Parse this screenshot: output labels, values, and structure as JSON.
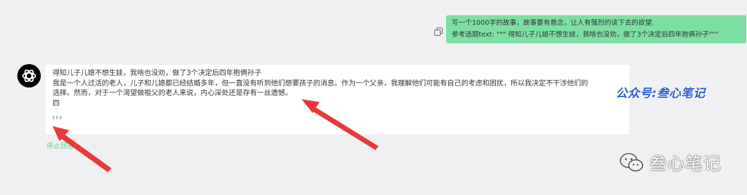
{
  "user_message": {
    "line1": "写一个1000字的故事，故事要有悬念，让人有强烈的读下去的欲望.",
    "line2": "参考选题text: \"\"\" 得知儿子儿媳不想生娃，我啥也没劝，做了3个决定后四年抱俩孙子\"\"\""
  },
  "assistant_message": {
    "title": "得知儿子儿媳不想生娃，我啥也没劝，做了3个决定后四年抱俩孙子",
    "para_line1": "我是一个人过活的老人，儿子和儿媳都已经结婚多年，但一直没有听到他们想要孩子的消息。作为一个父亲，我理解他们可能有自己的考虑和困扰，所以我决定不干涉他们的",
    "para_line2": "选择。然而，对于一个渴望做祖父的老人来说，内心深处还是存有一丝遗憾。",
    "partial": "四"
  },
  "controls": {
    "stop_label": "停止回答"
  },
  "watermarks": {
    "top": "公众号:叁心笔记",
    "bottom": "叁心笔记"
  },
  "colors": {
    "user_bubble": "#7ce0a2",
    "arrow": "#e8393b",
    "accent": "#5cd08f"
  },
  "icons": {
    "copy": "copy-icon",
    "avatar": "chatgpt-logo-icon",
    "wechat": "wechat-icon"
  }
}
